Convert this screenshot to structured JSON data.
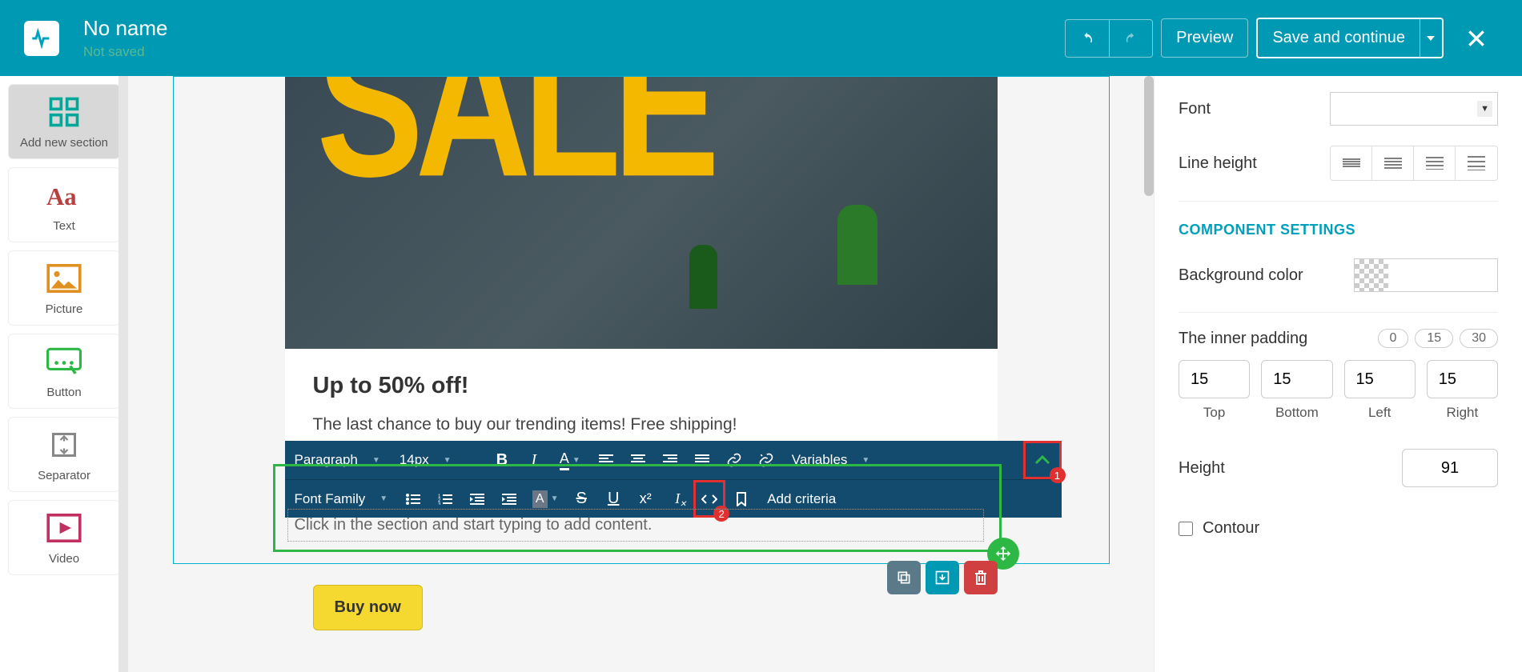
{
  "header": {
    "title": "No name",
    "subtitle": "Not saved",
    "preview": "Preview",
    "save": "Save and continue"
  },
  "sidebar": {
    "items": [
      {
        "label": "Add new section"
      },
      {
        "label": "Text"
      },
      {
        "label": "Picture"
      },
      {
        "label": "Button"
      },
      {
        "label": "Separator"
      },
      {
        "label": "Video"
      }
    ]
  },
  "canvas": {
    "hero_word": "SALE",
    "heading": "Up to 50% off!",
    "paragraph": "The last chance to buy our trending items! Free shipping!",
    "placeholder": "Click in the section and start typing to add content.",
    "buy_now": "Buy now"
  },
  "rte": {
    "block": "Paragraph",
    "size": "14px",
    "variables": "Variables",
    "font_family": "Font Family",
    "add_criteria": "Add criteria",
    "badge1": "1",
    "badge2": "2"
  },
  "panel": {
    "font": "Font",
    "line_height": "Line height",
    "section_title": "COMPONENT SETTINGS",
    "bg_color": "Background color",
    "inner_padding": "The inner padding",
    "pills": [
      "0",
      "15",
      "30"
    ],
    "pad": {
      "top": "15",
      "bottom": "15",
      "left": "15",
      "right": "15"
    },
    "pad_labels": {
      "top": "Top",
      "bottom": "Bottom",
      "left": "Left",
      "right": "Right"
    },
    "height_label": "Height",
    "height_value": "91",
    "contour": "Contour"
  }
}
